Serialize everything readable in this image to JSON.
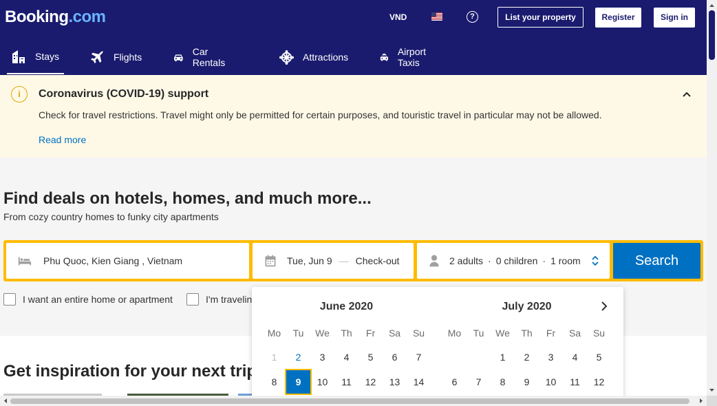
{
  "header": {
    "logo": "Booking",
    "logo_suffix": ".com",
    "currency": "VND",
    "help": "?",
    "list_property": "List your property",
    "register": "Register",
    "sign_in": "Sign in"
  },
  "nav": {
    "items": [
      {
        "label": "Stays",
        "icon": "bed-building-icon",
        "active": true
      },
      {
        "label": "Flights",
        "icon": "plane-icon"
      },
      {
        "label": "Car Rentals",
        "icon": "car-icon"
      },
      {
        "label": "Attractions",
        "icon": "ferris-wheel-icon"
      },
      {
        "label": "Airport Taxis",
        "icon": "taxi-icon"
      }
    ]
  },
  "covid": {
    "icon": "i",
    "title": "Coronavirus (COVID-19) support",
    "text": "Check for travel restrictions. Travel might only be permitted for certain purposes, and touristic travel in particular may not be allowed.",
    "link": "Read more"
  },
  "hero": {
    "title": "Find deals on hotels, homes, and much more...",
    "subtitle": "From cozy country homes to funky city apartments"
  },
  "search": {
    "destination": "Phu Quoc, Kien Giang , Vietnam",
    "checkin": "Tue, Jun 9",
    "dash": "—",
    "checkout": "Check-out",
    "adults": "2 adults",
    "children": "0 children",
    "rooms": "1 room",
    "sep": "·",
    "button": "Search"
  },
  "options": {
    "entire_home": "I want an entire home or apartment",
    "work_travel": "I'm travelin"
  },
  "inspire": {
    "title": "Get inspiration for your next trip"
  },
  "calendar": {
    "weekdays": [
      "Mo",
      "Tu",
      "We",
      "Th",
      "Fr",
      "Sa",
      "Su"
    ],
    "months": [
      {
        "title": "June 2020",
        "rows": [
          [
            "1",
            "2",
            "3",
            "4",
            "5",
            "6",
            "7"
          ],
          [
            "8",
            "9",
            "10",
            "11",
            "12",
            "13",
            "14"
          ]
        ]
      },
      {
        "title": "July 2020",
        "rows": [
          [
            "",
            "",
            "1",
            "2",
            "3",
            "4",
            "5"
          ],
          [
            "6",
            "7",
            "8",
            "9",
            "10",
            "11",
            "12"
          ]
        ]
      }
    ]
  },
  "colors": {
    "brand_navy": "#1a1b6e",
    "accent_blue": "#0071c2",
    "search_yellow": "#febb02"
  }
}
